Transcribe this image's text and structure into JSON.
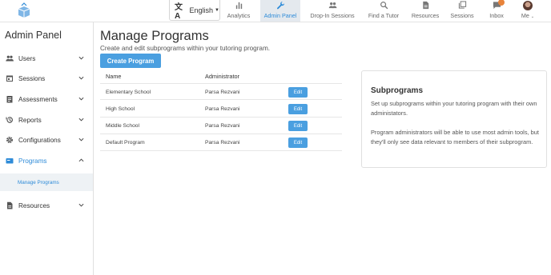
{
  "topbar": {
    "language": "English",
    "nav": [
      {
        "label": "Analytics",
        "icon": "bar-chart-icon"
      },
      {
        "label": "Admin Panel",
        "icon": "wrench-icon",
        "active": true
      },
      {
        "label": "Drop-In Sessions",
        "icon": "people-icon"
      },
      {
        "label": "Find a Tutor",
        "icon": "search-icon"
      },
      {
        "label": "Resources",
        "icon": "document-icon"
      },
      {
        "label": "Sessions",
        "icon": "stack-icon"
      },
      {
        "label": "Inbox",
        "icon": "chat-icon"
      },
      {
        "label": "Me",
        "icon": "avatar"
      }
    ]
  },
  "sidebar": {
    "title": "Admin Panel",
    "items": [
      {
        "label": "Users",
        "icon": "users-icon"
      },
      {
        "label": "Sessions",
        "icon": "calendar-icon"
      },
      {
        "label": "Assessments",
        "icon": "clipboard-icon"
      },
      {
        "label": "Reports",
        "icon": "history-icon"
      },
      {
        "label": "Configurations",
        "icon": "gear-icon"
      },
      {
        "label": "Programs",
        "icon": "folder-icon",
        "active": true
      },
      {
        "label": "Resources",
        "icon": "document-icon"
      }
    ],
    "subitem": "Manage Programs"
  },
  "main": {
    "title": "Manage Programs",
    "subtitle": "Create and edit subprograms within your tutoring program.",
    "create_button": "Create Program",
    "table": {
      "columns": [
        "Name",
        "Administrator"
      ],
      "rows": [
        {
          "name": "Elementary School",
          "admin": "Parsa Rezvani",
          "action": "Edit"
        },
        {
          "name": "High School",
          "admin": "Parsa Rezvani",
          "action": "Edit"
        },
        {
          "name": "Middle School",
          "admin": "Parsa Rezvani",
          "action": "Edit"
        },
        {
          "name": "Default Program",
          "admin": "Parsa Rezvani",
          "action": "Edit"
        }
      ]
    },
    "info": {
      "title": "Subprograms",
      "p1": "Set up subprograms within your tutoring program with their own administators.",
      "p2": "Program administrators will be able to use most admin tools, but they'll only see data relevant to members of their subprogram."
    }
  },
  "colors": {
    "accent": "#2e8bd8",
    "button": "#4a9fe0",
    "nav_active_bg": "#e4e9ee",
    "badge": "#e8833a"
  }
}
